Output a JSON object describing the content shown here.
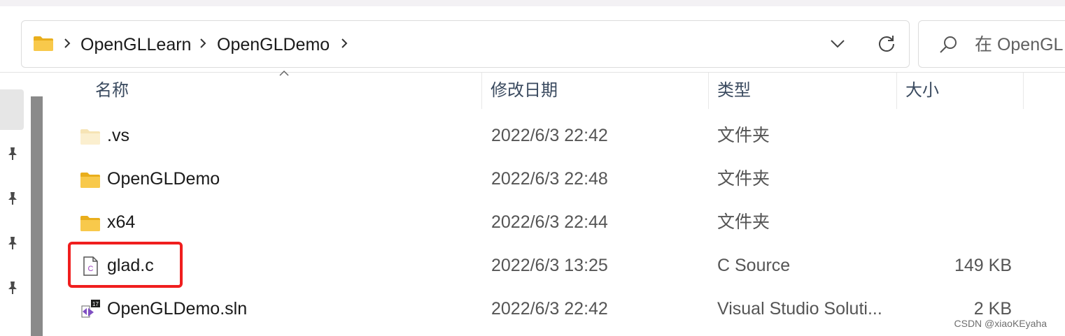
{
  "address_bar": {
    "breadcrumbs": [
      "OpenGLLearn",
      "OpenGLDemo"
    ]
  },
  "search": {
    "placeholder": "在 OpenGLDemo 中搜索",
    "visible_text": "在 OpenGL"
  },
  "columns": {
    "name": "名称",
    "date": "修改日期",
    "type": "类型",
    "size": "大小"
  },
  "files": [
    {
      "name": ".vs",
      "date": "2022/6/3 22:42",
      "type": "文件夹",
      "size": "",
      "icon": "folder-icon"
    },
    {
      "name": "OpenGLDemo",
      "date": "2022/6/3 22:48",
      "type": "文件夹",
      "size": "",
      "icon": "folder-icon"
    },
    {
      "name": "x64",
      "date": "2022/6/3 22:44",
      "type": "文件夹",
      "size": "",
      "icon": "folder-icon"
    },
    {
      "name": "glad.c",
      "date": "2022/6/3 13:25",
      "type": "C Source",
      "size": "149 KB",
      "icon": "c-source-file-icon"
    },
    {
      "name": "OpenGLDemo.sln",
      "date": "2022/6/3 22:42",
      "type": "Visual Studio Soluti...",
      "size": "2 KB",
      "icon": "visual-studio-solution-icon"
    }
  ],
  "highlight": {
    "color": "#f01e1e"
  },
  "colors": {
    "folder": "#f8c94b",
    "folder_dark": "#e9ae1c",
    "vs_purple": "#7f4fc2"
  },
  "watermark": "CSDN @xiaoKEyaha"
}
